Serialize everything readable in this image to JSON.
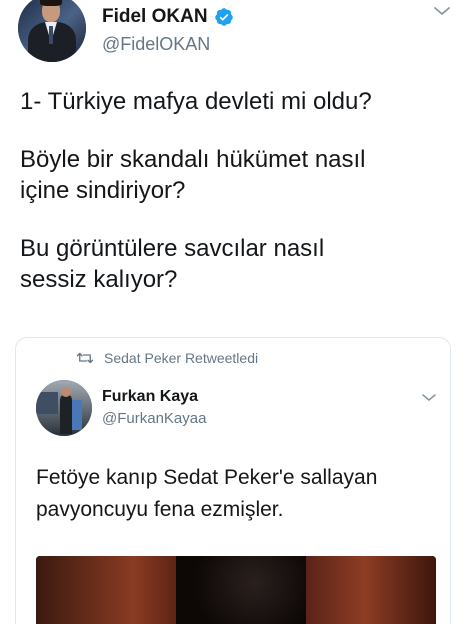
{
  "tweet": {
    "display_name": "Fidel OKAN",
    "handle": "@FidelOKAN",
    "verified": true,
    "text_lines": [
      "1- Türkiye mafya devleti mi oldu?",
      "Böyle bir skandalı hükümet nasıl\niçine sindiriyor?",
      "Bu görüntülere savcılar nasıl\nsessiz kalıyor?"
    ]
  },
  "quoted": {
    "retweet_label": "Sedat Peker Retweetledi",
    "display_name": "Furkan Kaya",
    "handle": "@FurkanKayaa",
    "text": "Fetöye kanıp Sedat Peker'e sallayan\npavyoncuyu fena ezmişler."
  },
  "icons": {
    "verified": "verified-badge-icon",
    "chevron": "chevron-down-icon",
    "retweet": "retweet-icon"
  },
  "colors": {
    "verified_blue": "#1da1f2",
    "secondary_text": "#657786",
    "primary_text": "#14171a",
    "border": "#e1e8ed"
  }
}
